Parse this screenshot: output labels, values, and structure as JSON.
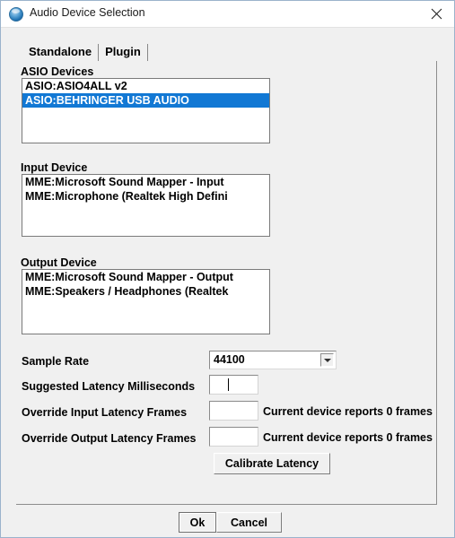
{
  "window": {
    "title": "Audio Device Selection",
    "icon": "audio-device-icon",
    "close_icon": "close-icon",
    "accent_selection_color": "#1278d4",
    "background_color": "#f0f0f0"
  },
  "tabs": [
    {
      "label": "Standalone",
      "selected": true
    },
    {
      "label": "Plugin",
      "selected": false
    }
  ],
  "groups": {
    "asio_devices": {
      "label": "ASIO Devices",
      "items": [
        {
          "label": "ASIO:ASIO4ALL v2",
          "selected": false
        },
        {
          "label": "ASIO:BEHRINGER USB AUDIO",
          "selected": true
        }
      ]
    },
    "input_device": {
      "label": "Input Device",
      "items": [
        {
          "label": "MME:Microsoft Sound Mapper - Input",
          "selected": false
        },
        {
          "label": "MME:Microphone (Realtek High Defini",
          "selected": false
        }
      ]
    },
    "output_device": {
      "label": "Output Device",
      "items": [
        {
          "label": "MME:Microsoft Sound Mapper - Output",
          "selected": false
        },
        {
          "label": "MME:Speakers / Headphones (Realtek",
          "selected": false
        }
      ]
    }
  },
  "form": {
    "sample_rate": {
      "label": "Sample Rate",
      "value": "44100",
      "arrow_icon": "chevron-down-icon"
    },
    "suggested_latency": {
      "label": "Suggested Latency Milliseconds",
      "value": "",
      "placeholder": ""
    },
    "override_input_latency": {
      "label": "Override Input Latency Frames",
      "value": "",
      "placeholder": "",
      "info": "Current device reports 0 frames"
    },
    "override_output_latency": {
      "label": "Override Output Latency Frames",
      "value": "",
      "placeholder": "",
      "info": "Current device reports 0 frames"
    },
    "calibrate_button": "Calibrate Latency"
  },
  "footer": {
    "ok_label": "Ok",
    "cancel_label": "Cancel"
  }
}
